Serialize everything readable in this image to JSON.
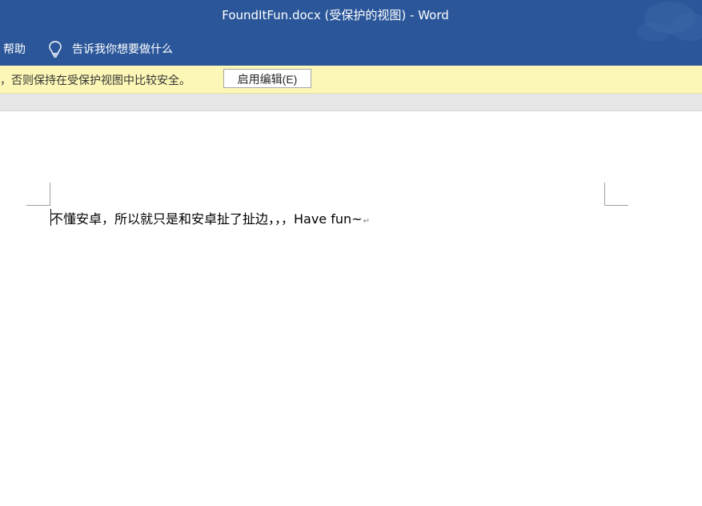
{
  "window": {
    "title": "FoundItFun.docx (受保护的视图)  -  Word"
  },
  "ribbon": {
    "help_tab": "帮助",
    "tell_me": "告诉我你想要做什么"
  },
  "message_bar": {
    "text": "，否则保持在受保护视图中比较安全。",
    "enable_button": "启用编辑(E)"
  },
  "document": {
    "paragraph": "不懂安卓，所以就只是和安卓扯了扯边，，，Have fun~",
    "paragraph_mark": "↵"
  },
  "colors": {
    "title_bar": "#2b579a",
    "message_bar": "#fcf7b6"
  },
  "icons": {
    "tell_me": "lightbulb-icon",
    "title_art": "cloud-icon"
  }
}
